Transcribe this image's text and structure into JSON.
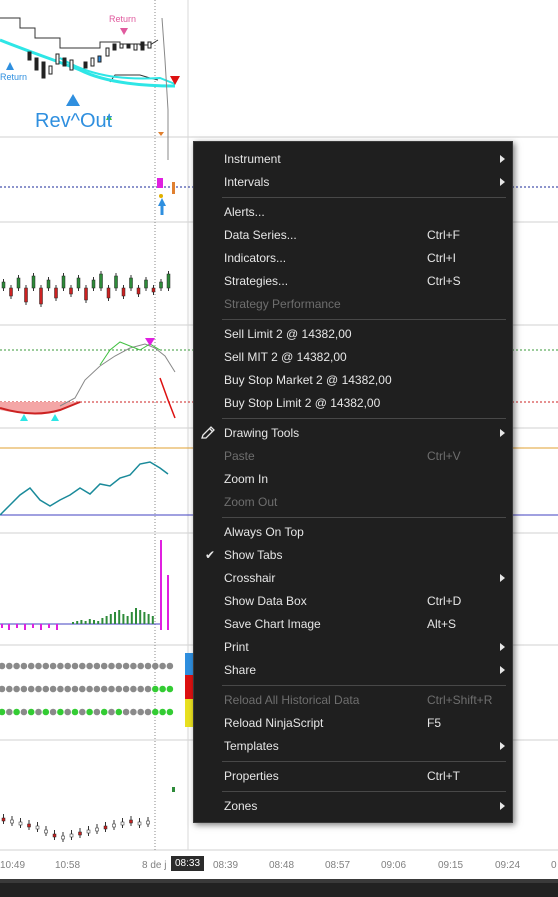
{
  "chart_annotations": {
    "return_top": "Return",
    "return_left": "Return",
    "rev_out": "Rev^Out"
  },
  "time_axis": {
    "labels": [
      "10:49",
      "10:58",
      "8 de j",
      "08:39",
      "08:48",
      "08:57",
      "09:06",
      "09:15",
      "09:24",
      "0"
    ],
    "current": "08:33"
  },
  "colors": {
    "menu_bg": "#1f1f1f",
    "menu_text": "#e6e6e6",
    "menu_disabled": "#6e6e6e",
    "rev_out": "#2f8fdf",
    "return": "#e05a9e",
    "cyan_line": "#2ee6e6",
    "bull": "#2e8b3a",
    "bear": "#cc2222"
  },
  "context_menu": {
    "instrument": "Instrument",
    "intervals": "Intervals",
    "alerts": "Alerts...",
    "data_series": "Data Series...",
    "data_series_sc": "Ctrl+F",
    "indicators": "Indicators...",
    "indicators_sc": "Ctrl+I",
    "strategies": "Strategies...",
    "strategies_sc": "Ctrl+S",
    "strategy_performance": "Strategy Performance",
    "sell_limit": "Sell Limit 2 @ 14382,00",
    "sell_mit": "Sell MIT 2 @ 14382,00",
    "buy_stop_market": "Buy Stop Market 2 @ 14382,00",
    "buy_stop_limit": "Buy Stop Limit 2 @ 14382,00",
    "drawing_tools": "Drawing Tools",
    "paste": "Paste",
    "paste_sc": "Ctrl+V",
    "zoom_in": "Zoom In",
    "zoom_out": "Zoom Out",
    "always_on_top": "Always On Top",
    "show_tabs": "Show Tabs",
    "show_tabs_check": "✔",
    "crosshair": "Crosshair",
    "show_data_box": "Show Data Box",
    "show_data_box_sc": "Ctrl+D",
    "save_chart_image": "Save Chart Image",
    "save_chart_image_sc": "Alt+S",
    "print": "Print",
    "share": "Share",
    "reload_historical": "Reload All Historical Data",
    "reload_historical_sc": "Ctrl+Shift+R",
    "reload_ninjascript": "Reload NinjaScript",
    "reload_ninjascript_sc": "F5",
    "templates": "Templates",
    "properties": "Properties",
    "properties_sc": "Ctrl+T",
    "zones": "Zones"
  }
}
